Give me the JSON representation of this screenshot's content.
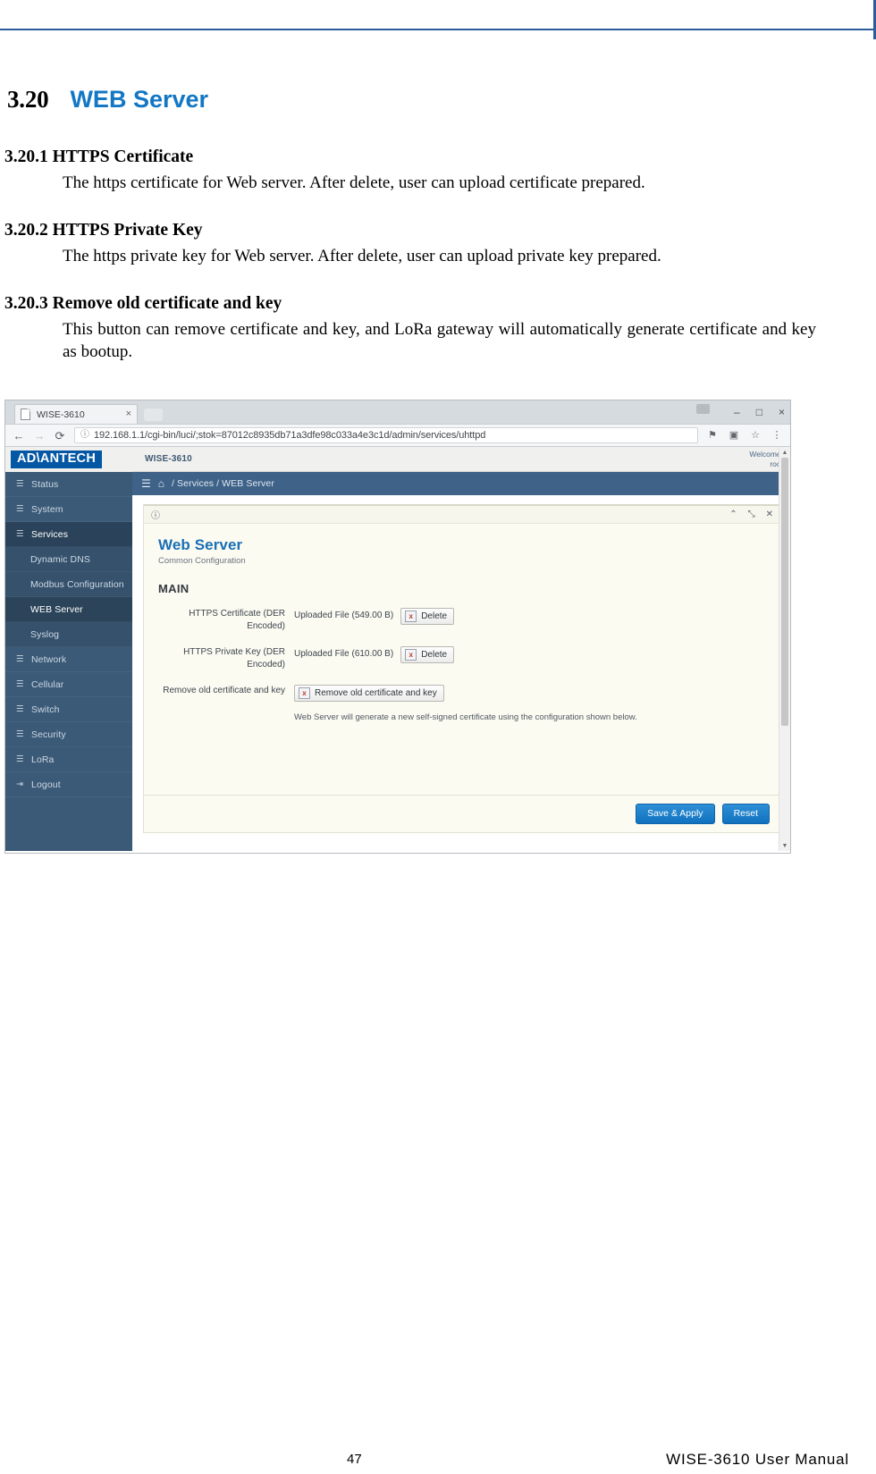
{
  "document": {
    "section": {
      "number": "3.20",
      "title": "WEB Server"
    },
    "subsections": [
      {
        "heading": "3.20.1 HTTPS Certificate",
        "body": "The https certificate for Web server. After delete, user can upload certificate prepared."
      },
      {
        "heading": "3.20.2 HTTPS Private Key",
        "body": "The https private key for Web server. After delete, user can upload private key prepared."
      },
      {
        "heading": "3.20.3 Remove old certificate and key",
        "body": "This button can remove certificate and key, and LoRa gateway will automatically generate certificate and key as bootup."
      }
    ],
    "footer": {
      "page_number": "47",
      "manual_title": "WISE-3610  User  Manual"
    }
  },
  "browser": {
    "tab": {
      "title": "WISE-3610",
      "close_label": "×"
    },
    "window_controls": {
      "minimize": "–",
      "maximize": "□",
      "close": "×"
    },
    "nav": {
      "back": "←",
      "forward": "→",
      "reload": "⟳",
      "info_icon": "ⓘ",
      "url": "192.168.1.1/cgi-bin/luci/;stok=87012c8935db71a3dfe98c033a4e3c1d/admin/services/uhttpd",
      "pin_icon": "⚑",
      "cast_icon": "▣",
      "star_icon": "☆",
      "menu_icon": "⋮"
    }
  },
  "app": {
    "logo_text": "AD\\ANTECH",
    "model": "WISE-3610",
    "welcome": {
      "line1": "Welcome,",
      "line2": "root"
    },
    "breadcrumb": {
      "burger_icon": "☰",
      "home_icon": "⌂",
      "path": "/ Services / WEB Server"
    },
    "sidebar": [
      {
        "label": "Status",
        "icon": "list-icon",
        "level": "top",
        "active": false
      },
      {
        "label": "System",
        "icon": "list-icon",
        "level": "top",
        "active": false
      },
      {
        "label": "Services",
        "icon": "list-icon",
        "level": "top",
        "active": true
      },
      {
        "label": "Dynamic DNS",
        "icon": "",
        "level": "sub",
        "active": false
      },
      {
        "label": "Modbus Configuration",
        "icon": "",
        "level": "sub",
        "active": false
      },
      {
        "label": "WEB Server",
        "icon": "",
        "level": "sub",
        "active": true
      },
      {
        "label": "Syslog",
        "icon": "",
        "level": "sub",
        "active": false
      },
      {
        "label": "Network",
        "icon": "list-icon",
        "level": "top",
        "active": false
      },
      {
        "label": "Cellular",
        "icon": "list-icon",
        "level": "top",
        "active": false
      },
      {
        "label": "Switch",
        "icon": "list-icon",
        "level": "top",
        "active": false
      },
      {
        "label": "Security",
        "icon": "list-icon",
        "level": "top",
        "active": false
      },
      {
        "label": "LoRa",
        "icon": "list-icon",
        "level": "top",
        "active": false
      },
      {
        "label": "Logout",
        "icon": "logout-icon",
        "level": "top",
        "active": false
      }
    ],
    "panel": {
      "toolbar": {
        "info_icon": "ⓘ",
        "collapse_icon": "⌃",
        "expand_icon": "⤡",
        "close_icon": "✕"
      },
      "title": "Web Server",
      "subtitle": "Common Configuration",
      "section_title": "MAIN",
      "fields": [
        {
          "label": "HTTPS Certificate (DER Encoded)",
          "value": "Uploaded File (549.00 B)",
          "button": "Delete",
          "note": ""
        },
        {
          "label": "HTTPS Private Key (DER Encoded)",
          "value": "Uploaded File (610.00 B)",
          "button": "Delete",
          "note": ""
        },
        {
          "label": "Remove old certificate and key",
          "value": "",
          "button": "Remove old certificate and key",
          "note": "Web Server will generate a new self-signed certificate using the configuration shown below."
        }
      ],
      "footer_buttons": {
        "save": "Save & Apply",
        "reset": "Reset"
      }
    }
  }
}
